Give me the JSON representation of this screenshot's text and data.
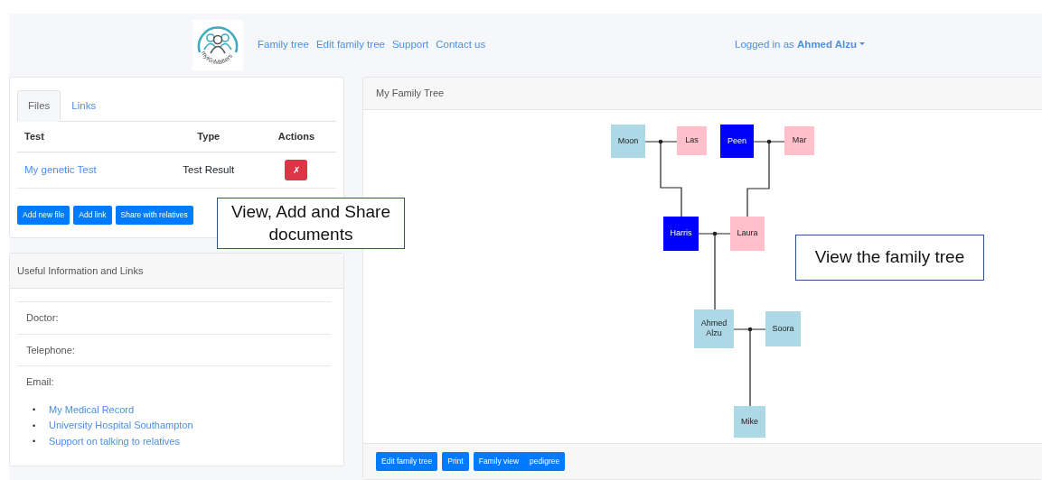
{
  "brand": {
    "logo_text": "myKinMatters"
  },
  "nav": [
    "Family tree",
    "Edit family tree",
    "Support",
    "Contact us"
  ],
  "user": {
    "prefix": "Logged in as",
    "name": "Ahmed Alzu"
  },
  "files_panel": {
    "tabs": [
      {
        "label": "Files",
        "selected": true
      },
      {
        "label": "Links",
        "selected": false
      }
    ],
    "table": {
      "columns": [
        "Test",
        "Type",
        "Actions"
      ],
      "rows": [
        {
          "name": "My genetic Test",
          "type": "Test Result",
          "action": "✗"
        }
      ]
    },
    "buttons": [
      "Add new file",
      "Add link",
      "Share with relatives"
    ]
  },
  "info_panel": {
    "title": "Useful Information and Links",
    "fields": [
      "Doctor:",
      "Telephone:",
      "Email:"
    ],
    "links": [
      {
        "marker": "•",
        "label": "My Medical Record"
      },
      {
        "marker": "•",
        "label": "University Hospital Southampton"
      },
      {
        "marker": "•",
        "label": "Support on talking to relatives"
      }
    ]
  },
  "tree_panel": {
    "title": "My Family Tree",
    "people": [
      {
        "name": "Moon",
        "color": "#add8e6"
      },
      {
        "name": "Las",
        "color": "#ffc0cb"
      },
      {
        "name": "Peen",
        "color": "#0000ff"
      },
      {
        "name": "Mar",
        "color": "#ffc0cb"
      },
      {
        "name": "Harris",
        "color": "#0000ff"
      },
      {
        "name": "Laura",
        "color": "#ffc0cb"
      },
      {
        "name": "Ahmed Alzu",
        "color": "#add8e6"
      },
      {
        "name": "Soora",
        "color": "#add8e6"
      },
      {
        "name": "Mike",
        "color": "#add8e6"
      }
    ],
    "buttons": [
      {
        "labels": [
          "Edit family tree"
        ]
      },
      {
        "labels": [
          "Print"
        ]
      },
      {
        "labels": [
          "Family view",
          "pedigree"
        ]
      }
    ]
  },
  "callouts": [
    "View, Add and Share documents",
    "View the family tree"
  ]
}
